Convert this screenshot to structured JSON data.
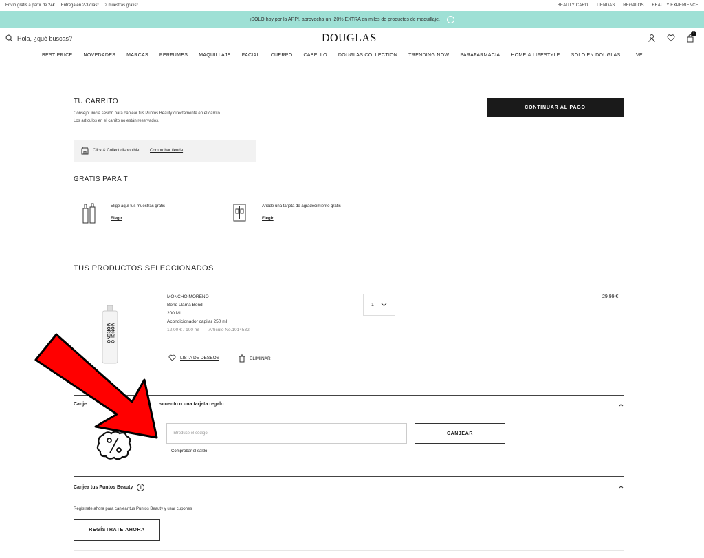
{
  "topbar": {
    "left": [
      "Envío gratis a partir de 24€",
      "Entrega en 2-3 días*",
      "2 muestras gratis*"
    ],
    "right": [
      "BEAUTY CARD",
      "TIENDAS",
      "REGALOS",
      "BEAUTY EXPERIENCE"
    ]
  },
  "promo": {
    "text": "¡SOLO hoy por la APP!, aprovecha un -20% EXTRA en miles de productos de maquillaje."
  },
  "header": {
    "search_placeholder": "Hola, ¿qué buscas?",
    "logo": "DOUGLAS",
    "cart_count": "1"
  },
  "nav": [
    "BEST PRICE",
    "NOVEDADES",
    "MARCAS",
    "PERFUMES",
    "MAQUILLAJE",
    "FACIAL",
    "CUERPO",
    "CABELLO",
    "DOUGLAS COLLECTION",
    "TRENDING NOW",
    "PARAFARMACIA",
    "HOME & LIFESTYLE",
    "SOLO EN DOUGLAS",
    "LIVE"
  ],
  "cart": {
    "title": "TU CARRITO",
    "tip1": "Consejo: inicia sesión para canjear tus Puntos Beauty directamente en el carrito.",
    "tip2": "Los artículos en el carrito no están reservados.",
    "checkout": "CONTINUAR AL PAGO",
    "cc_label": "Click & Collect disponible:",
    "cc_link": "Comprobar tienda"
  },
  "gifts": {
    "title": "GRATIS PARA TI",
    "samples_text": "Elige aquí tus muestras gratis",
    "samples_link": "Elegir",
    "card_text": "Añade una tarjeta de agradecimiento gratis",
    "card_link": "Elegir"
  },
  "products": {
    "title": "TUS PRODUCTOS SELECCIONADOS",
    "item": {
      "brand": "MONCHO MORENO",
      "name": "Bond Llama Bond",
      "size": "200 Ml",
      "desc": "Acondicionador capilar 250 ml",
      "unit_price": "12,00 € / 100 ml",
      "article": "Artículo No.1014532",
      "qty": "1",
      "price": "29,99 €",
      "wishlist": "LISTA DE DESEOS",
      "remove": "ELIMINAR",
      "bottle_label": "MONCHO MORENO"
    }
  },
  "voucher": {
    "title_start": "Canje",
    "title_end": "scuento o una tarjeta regalo",
    "placeholder": "Introduce el código",
    "button": "CANJEAR",
    "balance_link": "Comprobar el saldo"
  },
  "points": {
    "title": "Canjea tus Puntos Beauty",
    "text": "Regístrate ahora para canjear tus Puntos Beauty y usar cupones",
    "button": "REGÍSTRATE AHORA"
  },
  "colors": {
    "promo": "#9ee0d5",
    "dark": "#1a1a1a",
    "arrow": "#ff0000"
  }
}
